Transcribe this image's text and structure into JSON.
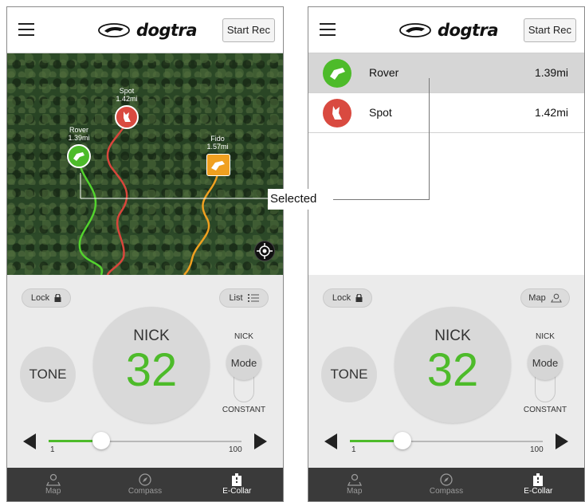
{
  "brand": {
    "name": "dogtra"
  },
  "header": {
    "start_rec_label": "Start Rec"
  },
  "map_markers": [
    {
      "name": "Rover",
      "distance": "1.39mi",
      "color": "#4dbb2a"
    },
    {
      "name": "Spot",
      "distance": "1.42mi",
      "color": "#d94a40"
    },
    {
      "name": "Fido",
      "distance": "1.57mi",
      "color": "#f0a020"
    }
  ],
  "dog_list": [
    {
      "name": "Rover",
      "distance": "1.39mi",
      "color": "#4dbb2a",
      "selected": true
    },
    {
      "name": "Spot",
      "distance": "1.42mi",
      "color": "#d94a40",
      "selected": false
    }
  ],
  "controls_left": {
    "lock_label": "Lock",
    "toggle_label": "List",
    "stimulation_type": "NICK",
    "intensity": "32",
    "tone_label": "TONE",
    "mode_top_label": "NICK",
    "mode_label": "Mode",
    "mode_bottom_label": "CONSTANT",
    "slider_min": "1",
    "slider_max": "100",
    "slider_value": 32
  },
  "controls_right": {
    "lock_label": "Lock",
    "toggle_label": "Map",
    "stimulation_type": "NICK",
    "intensity": "32",
    "tone_label": "TONE",
    "mode_top_label": "NICK",
    "mode_label": "Mode",
    "mode_bottom_label": "CONSTANT",
    "slider_min": "1",
    "slider_max": "100",
    "slider_value": 32
  },
  "tabs": [
    {
      "label": "Map",
      "active": false
    },
    {
      "label": "Compass",
      "active": false
    },
    {
      "label": "E-Collar",
      "active": true
    }
  ],
  "annotation": {
    "label": "Selected"
  },
  "colors": {
    "accent": "#4dbb2a",
    "spot": "#d94a40",
    "fido": "#f0a020",
    "tabbar": "#3a3a3a"
  }
}
